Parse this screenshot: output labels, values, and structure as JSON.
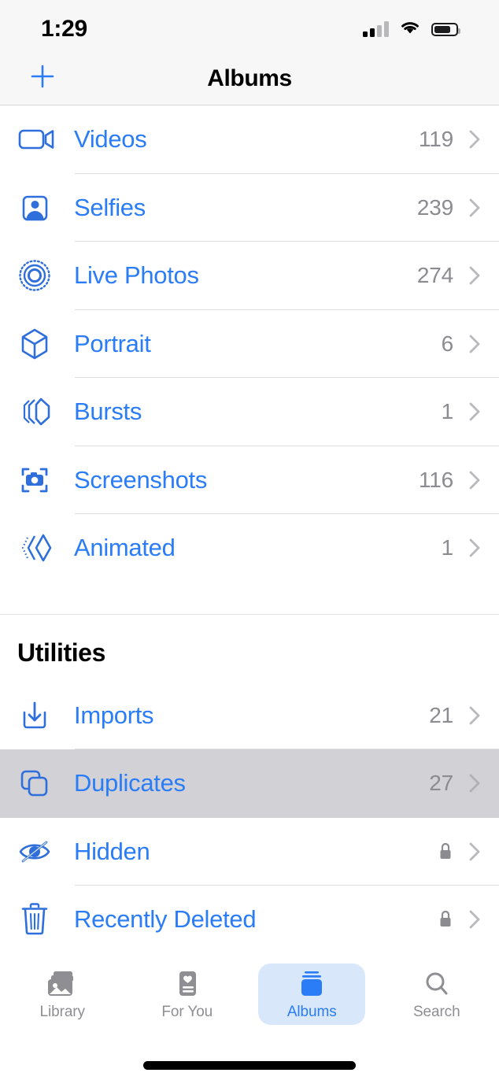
{
  "status_bar": {
    "time": "1:29",
    "cellular_icon": "cellular-signal-icon",
    "cellular_bars_filled": 2,
    "cellular_bars_total": 4,
    "wifi_icon": "wifi-icon",
    "battery_icon": "battery-icon",
    "battery_level_percent": 72
  },
  "nav_bar": {
    "add_icon": "plus-icon",
    "title": "Albums"
  },
  "colors": {
    "accent_blue": "#2a7cf7",
    "icon_blue": "#2f6fdb",
    "count_gray": "#8b8b90",
    "selected_row_gray": "#d1d1d6",
    "tab_active_pill": "#d9e7fb",
    "tab_inactive_gray": "#8e8e93"
  },
  "media_types": {
    "rows": [
      {
        "label": "Videos",
        "count": "119",
        "icon": "video-camera-icon",
        "chevron": "chevron-right-icon",
        "selected": false
      },
      {
        "label": "Selfies",
        "count": "239",
        "icon": "person-portrait-icon",
        "chevron": "chevron-right-icon",
        "selected": false
      },
      {
        "label": "Live Photos",
        "count": "274",
        "icon": "live-photo-icon",
        "chevron": "chevron-right-icon",
        "selected": false
      },
      {
        "label": "Portrait",
        "count": "6",
        "icon": "cube-icon",
        "chevron": "chevron-right-icon",
        "selected": false
      },
      {
        "label": "Bursts",
        "count": "1",
        "icon": "burst-stack-icon",
        "chevron": "chevron-right-icon",
        "selected": false
      },
      {
        "label": "Screenshots",
        "count": "116",
        "icon": "screenshot-camera-icon",
        "chevron": "chevron-right-icon",
        "selected": false
      },
      {
        "label": "Animated",
        "count": "1",
        "icon": "animated-diamond-icon",
        "chevron": "chevron-right-icon",
        "selected": false
      }
    ]
  },
  "utilities": {
    "title": "Utilities",
    "rows": [
      {
        "label": "Imports",
        "count": "21",
        "icon": "import-tray-icon",
        "chevron": "chevron-right-icon",
        "locked": false,
        "selected": false
      },
      {
        "label": "Duplicates",
        "count": "27",
        "icon": "duplicate-squares-icon",
        "chevron": "chevron-right-icon",
        "locked": false,
        "selected": true
      },
      {
        "label": "Hidden",
        "count": "",
        "icon": "eye-slash-icon",
        "chevron": "chevron-right-icon",
        "locked": true,
        "lock_icon": "lock-icon",
        "selected": false
      },
      {
        "label": "Recently Deleted",
        "count": "",
        "icon": "trash-icon",
        "chevron": "chevron-right-icon",
        "locked": true,
        "lock_icon": "lock-icon",
        "selected": false
      }
    ]
  },
  "tab_bar": {
    "tabs": [
      {
        "label": "Library",
        "icon": "photo-stack-icon",
        "active": false
      },
      {
        "label": "For You",
        "icon": "heart-card-icon",
        "active": false
      },
      {
        "label": "Albums",
        "icon": "albums-stack-icon",
        "active": true
      },
      {
        "label": "Search",
        "icon": "magnifier-icon",
        "active": false
      }
    ]
  },
  "home_indicator": "home-indicator-bar"
}
